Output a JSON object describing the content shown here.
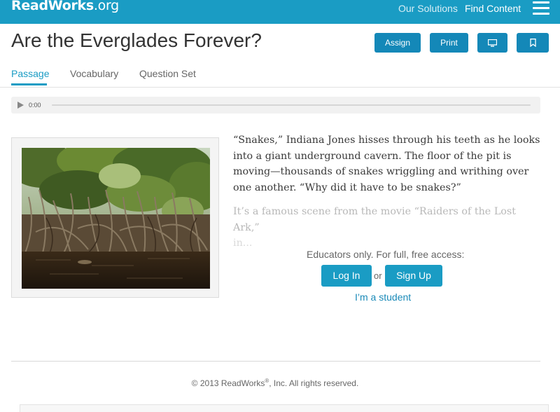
{
  "header": {
    "logo_main": "ReadWorks",
    "logo_suffix": ".org",
    "nav": {
      "solutions": "Our Solutions",
      "find_content": "Find Content"
    }
  },
  "article": {
    "title": "Are the Everglades Forever?",
    "actions": {
      "assign": "Assign",
      "print": "Print"
    },
    "tabs": {
      "passage": "Passage",
      "vocabulary": "Vocabulary",
      "question_set": "Question Set"
    },
    "audio": {
      "time": "0:00"
    },
    "paragraphs": [
      "“Snakes,” Indiana Jones hisses through his teeth as he looks into a giant underground cavern. The floor of the pit is moving—thousands of snakes wriggling and writhing over one another. “Why did it have to be snakes?”",
      "It’s a famous scene from the movie “Raiders of the Lost Ark,”",
      "in..."
    ]
  },
  "access": {
    "note": "Educators only. For full, free access:",
    "login": "Log In",
    "or": "or",
    "signup": "Sign Up",
    "student": "I’m a student"
  },
  "footer": {
    "copyright_pre": "© 2013 ReadWorks",
    "registered": "®",
    "copyright_post": ", Inc. All rights reserved."
  },
  "colors": {
    "brand": "#1a9cc4",
    "button": "#1488b8"
  },
  "icons": [
    "hamburger-menu-icon",
    "presentation-monitor-icon",
    "bookmark-icon",
    "play-icon"
  ]
}
